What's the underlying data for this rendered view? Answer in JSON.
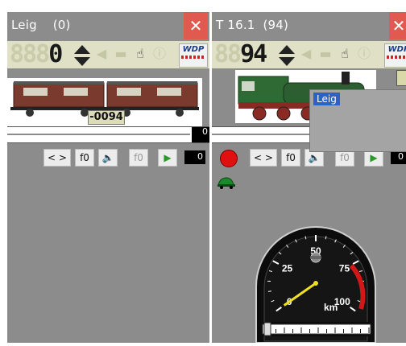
{
  "windows": [
    {
      "title": "Leig",
      "address": "(0)",
      "close_label": "✕",
      "speed_digits_ghost": "888",
      "speed_digits": "0",
      "manufacturer_logo": "WDP",
      "loco_number_label": "-0094",
      "slider_value": "0",
      "buttons": {
        "direction": "< >",
        "f0": "f0",
        "sound_icon": "sound-icon",
        "f0_alt": "f0",
        "play_icon": "play-icon"
      },
      "speed_value": "0"
    },
    {
      "title": "T 16.1",
      "address": "(94)",
      "close_label": "✕",
      "speed_digits_ghost": "88",
      "speed_digits": "94",
      "manufacturer_logo": "WDP",
      "slider_value": "0",
      "buttons": {
        "stop_icon": "stop-icon",
        "direction": "< >",
        "f0": "f0",
        "sound_icon": "sound-icon",
        "f0_alt": "f0",
        "play_icon": "play-icon"
      },
      "speed_value": "0",
      "popup_item": "Leig",
      "gauge": {
        "ticks": [
          "0",
          "25",
          "50",
          "75",
          "100"
        ],
        "unit": "km",
        "needle_value": 0,
        "max": 100
      }
    }
  ],
  "colors": {
    "panel": "#8c8c8c",
    "speedbar": "#dfe0c6",
    "close": "#e05a50",
    "accent_blue": "#2a63c4",
    "needle": "#f0e020"
  }
}
